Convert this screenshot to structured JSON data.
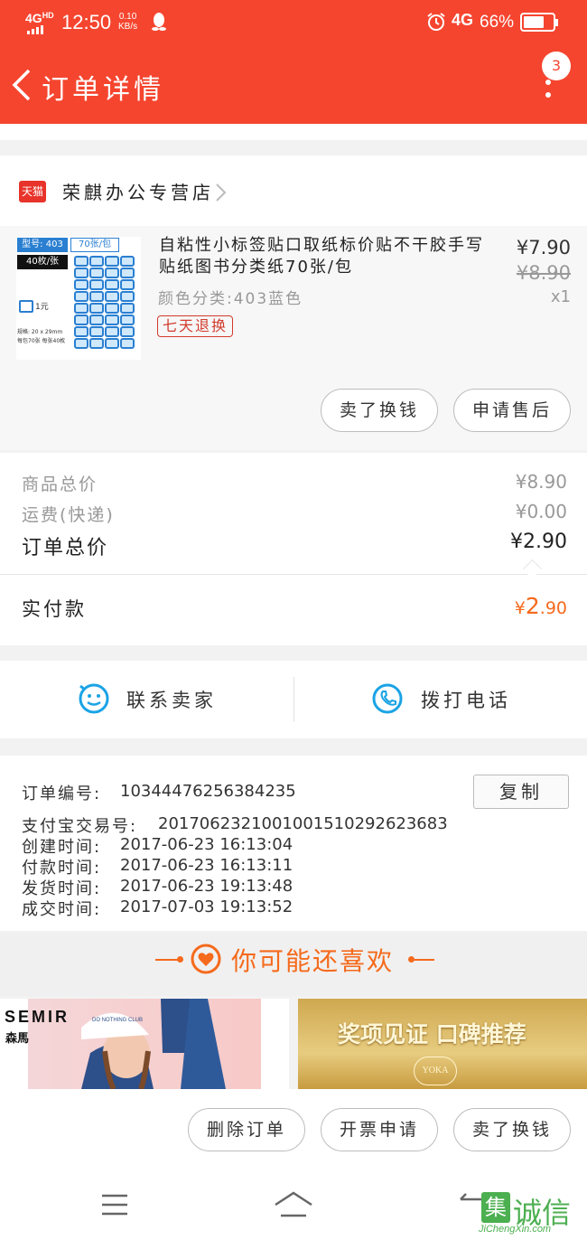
{
  "status_bar": {
    "network": "4G",
    "network_sup": "HD",
    "time": "12:50",
    "speed": "0.10",
    "speed_unit": "KB/s",
    "net2": "4G",
    "battery": "66%"
  },
  "header": {
    "title": "订单详情",
    "badge": "3"
  },
  "shop": {
    "badge": "天猫",
    "name": "荣麒办公专营店"
  },
  "product": {
    "title": "自粘性小标签贴口取纸标价贴不干胶手写贴纸图书分类纸70张/包",
    "spec": "颜色分类:403蓝色",
    "price": "¥7.90",
    "orig_price": "¥8.90",
    "qty": "x1",
    "tag": "七天退换",
    "image_labels": {
      "model": "型号: 403",
      "count": "70张/包",
      "sheets": "40枚/张",
      "price": "1元",
      "size": "规格: 20 x 29mm",
      "pack": "每包70张 每张40枚"
    }
  },
  "item_actions": {
    "sell": "卖了换钱",
    "after_sale": "申请售后"
  },
  "summary": {
    "goods_label": "商品总价",
    "goods_value": "¥8.90",
    "freight_label": "运费(快递)",
    "freight_value": "¥0.00",
    "total_label": "订单总价",
    "total_value": "¥2.90",
    "paid_label": "实付款",
    "paid_currency": "¥",
    "paid_int": "2",
    "paid_dec": ".90"
  },
  "contact": {
    "seller": "联系卖家",
    "phone": "拨打电话"
  },
  "order_info": {
    "no_label": "订单编号:",
    "no_value": "10344476256384235",
    "copy": "复制",
    "alipay_label": "支付宝交易号:",
    "alipay_value": "2017062321001001510292623683",
    "created_label": "创建时间:",
    "created_value": "2017-06-23 16:13:04",
    "paid_label": "付款时间:",
    "paid_value": "2017-06-23 16:13:11",
    "shipped_label": "发货时间:",
    "shipped_value": "2017-06-23 19:13:48",
    "done_label": "成交时间:",
    "done_value": "2017-07-03 19:13:52"
  },
  "recommend": {
    "title": "你可能还喜欢",
    "banner1_brand": "SEMIR",
    "banner1_brand_cn": "森馬",
    "banner1_cap": "DO NOTHING CLUB",
    "banner2_text": "奖项见证 口碑推荐",
    "banner2_logo": "YOKA"
  },
  "bottom_actions": {
    "delete": "删除订单",
    "invoice": "开票申请",
    "sell": "卖了换钱"
  },
  "watermark": {
    "char1": "集",
    "char2": "诚信",
    "url": "JiChengXin.com"
  },
  "colors": {
    "accent": "#f5452f",
    "orange": "#f56a1c",
    "link": "#1aa3e6"
  }
}
